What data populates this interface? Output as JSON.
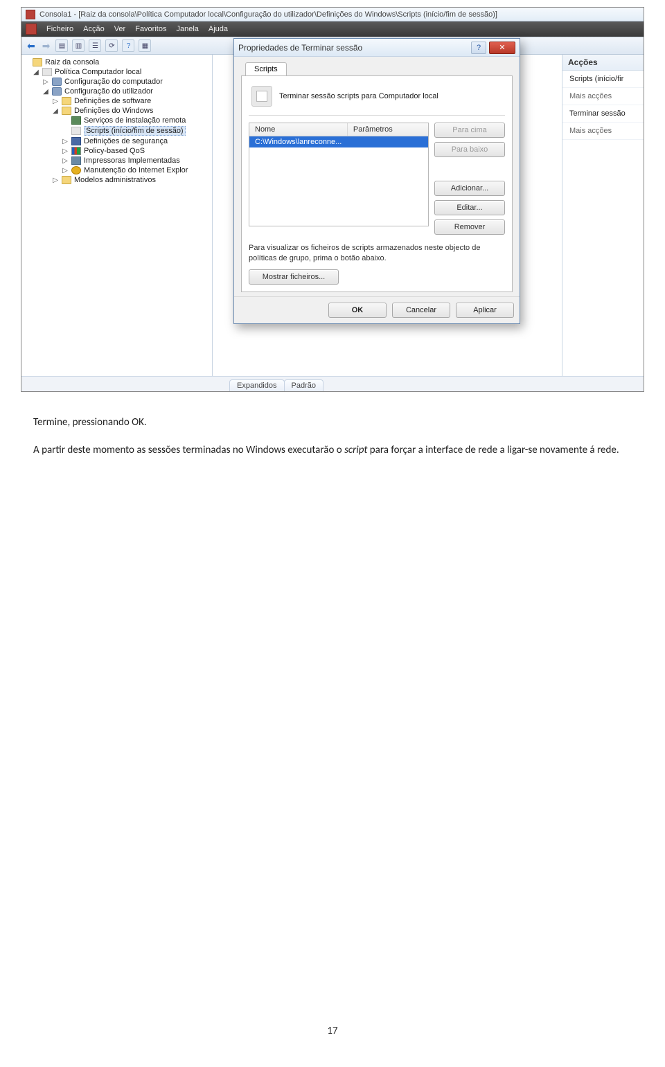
{
  "window": {
    "title": "Consola1 - [Raiz da consola\\Política Computador local\\Configuração do utilizador\\Definições do Windows\\Scripts (início/fim de sessão)]"
  },
  "menu": {
    "items": [
      "Ficheiro",
      "Acção",
      "Ver",
      "Favoritos",
      "Janela",
      "Ajuda"
    ]
  },
  "tree": {
    "root": "Raiz da consola",
    "n1": "Política Computador local",
    "n2": "Configuração do computador",
    "n3": "Configuração do utilizador",
    "n4": "Definições de software",
    "n5": "Definições do Windows",
    "n6": "Serviços de instalação remota",
    "n7": "Scripts (início/fim de sessão)",
    "n8": "Definições de segurança",
    "n9": "Policy-based QoS",
    "n10": "Impressoras Implementadas",
    "n11": "Manutenção do Internet Explor",
    "n12": "Modelos administrativos"
  },
  "actions": {
    "header": "Acções",
    "r1": "Scripts (início/fir",
    "r2": "Mais acções",
    "r3": "Terminar sessão",
    "r4": "Mais acções"
  },
  "dialog": {
    "title": "Propriedades de Terminar sessão",
    "tab": "Scripts",
    "desc": "Terminar sessão scripts para Computador local",
    "col_nome": "Nome",
    "col_param": "Parâmetros",
    "row_name": "C:\\Windows\\lanreconne...",
    "btn_up": "Para cima",
    "btn_down": "Para baixo",
    "btn_add": "Adicionar...",
    "btn_edit": "Editar...",
    "btn_remove": "Remover",
    "hint": "Para visualizar os ficheiros de scripts armazenados neste objecto de políticas de grupo, prima o botão abaixo.",
    "btn_showfiles": "Mostrar ficheiros...",
    "btn_ok": "OK",
    "btn_cancel": "Cancelar",
    "btn_apply": "Aplicar"
  },
  "bottom_tabs": {
    "t1": "Expandidos",
    "t2": "Padrão"
  },
  "doc": {
    "p1": "Termine, pressionando OK.",
    "p2a": "A partir deste momento as sessões terminadas no Windows executarão o ",
    "p2_italic": "script",
    "p2b": " para forçar a interface de rede a ligar-se novamente á rede.",
    "page": "17"
  }
}
